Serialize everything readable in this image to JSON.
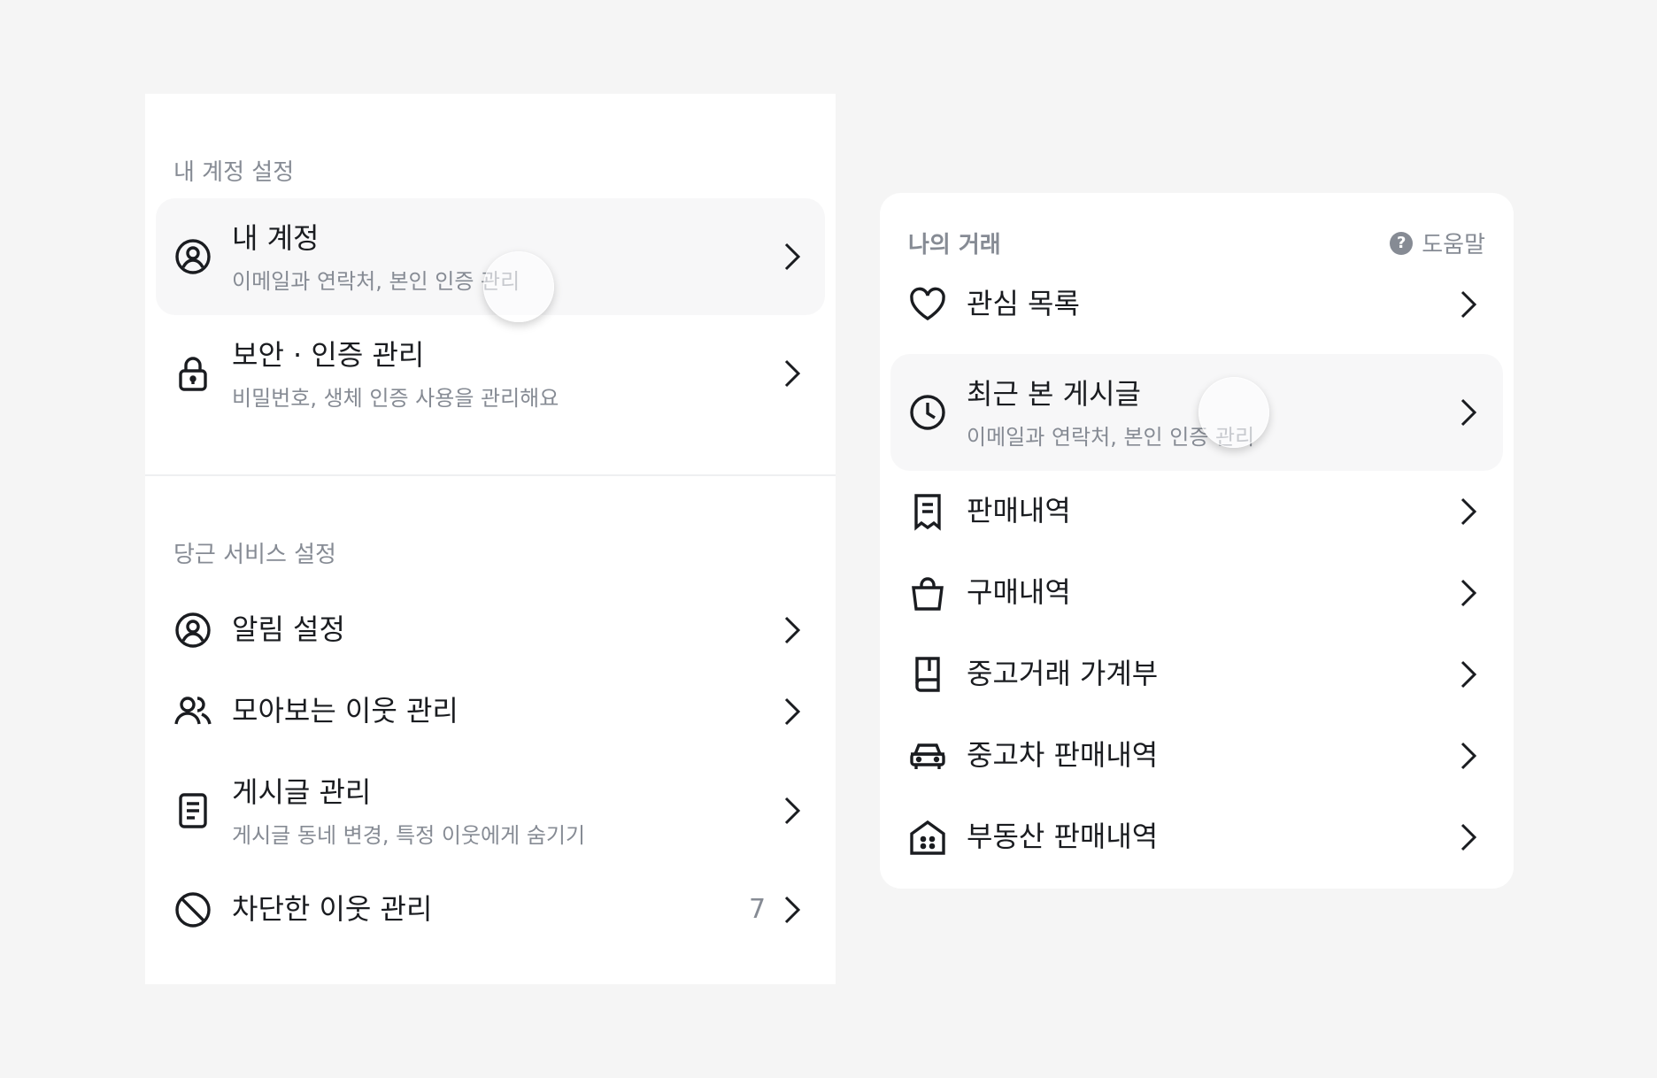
{
  "account_section": {
    "title": "내 계정 설정",
    "items": [
      {
        "label": "내 계정",
        "sub": "이메일과 연락처, 본인 인증 관리",
        "icon": "user-circle-icon"
      },
      {
        "label": "보안 · 인증 관리",
        "sub": "비밀번호, 생체 인증 사용을 관리해요",
        "icon": "lock-icon"
      }
    ]
  },
  "service_section": {
    "title": "당근 서비스 설정",
    "items": [
      {
        "label": "알림 설정",
        "icon": "user-circle-icon"
      },
      {
        "label": "모아보는 이웃 관리",
        "icon": "users-icon"
      },
      {
        "label": "게시글 관리",
        "sub": "게시글 동네 변경, 특정 이웃에게 숨기기",
        "icon": "document-icon"
      },
      {
        "label": "차단한 이웃 관리",
        "count": "7",
        "icon": "block-icon"
      }
    ]
  },
  "trade_section": {
    "title": "나의 거래",
    "help_label": "도움말",
    "items": [
      {
        "label": "관심 목록",
        "icon": "heart-icon"
      },
      {
        "label": "최근 본 게시글",
        "sub": "이메일과 연락처, 본인 인증 관리",
        "icon": "clock-icon"
      },
      {
        "label": "판매내역",
        "icon": "receipt-icon"
      },
      {
        "label": "구매내역",
        "icon": "shopping-bag-icon"
      },
      {
        "label": "중고거래 가계부",
        "icon": "book-icon"
      },
      {
        "label": "중고차 판매내역",
        "icon": "car-icon"
      },
      {
        "label": "부동산 판매내역",
        "icon": "house-icon"
      }
    ]
  },
  "colors": {
    "text": "#1a1c20",
    "muted": "#868b94",
    "highlight": "#f7f7f8"
  }
}
